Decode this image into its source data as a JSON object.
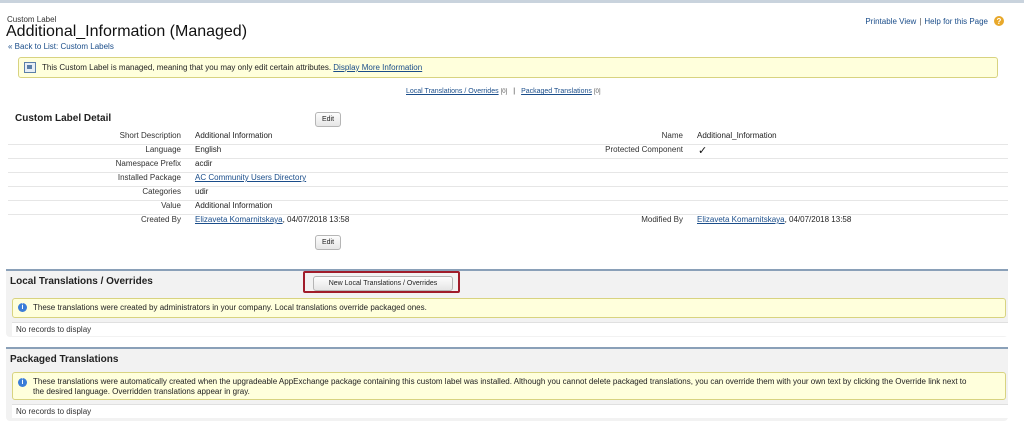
{
  "header": {
    "object_label": "Custom Label",
    "title": "Additional_Information (Managed)",
    "back_link": "« Back to List: Custom Labels",
    "printable_view": "Printable View",
    "separator": "|",
    "help": "Help for this Page",
    "help_icon_glyph": "?"
  },
  "notice": {
    "text": "This Custom Label is managed, meaning that you may only edit certain attributes.",
    "link": "Display More Information"
  },
  "related_links": {
    "local": "Local Translations / Overrides",
    "local_count": "[0]",
    "separator": "|",
    "packaged": "Packaged Translations",
    "packaged_count": "[0]"
  },
  "detail": {
    "title": "Custom Label Detail",
    "edit_label": "Edit",
    "fields": {
      "short_description_label": "Short Description",
      "short_description_value": "Additional Information",
      "name_label": "Name",
      "name_value": "Additional_Information",
      "language_label": "Language",
      "language_value": "English",
      "protected_label": "Protected Component",
      "protected_value": "✓",
      "namespace_label": "Namespace Prefix",
      "namespace_value": "acdir",
      "installed_package_label": "Installed Package",
      "installed_package_value": "AC Community Users Directory",
      "categories_label": "Categories",
      "categories_value": "udir",
      "value_label": "Value",
      "value_value": "Additional Information",
      "created_by_label": "Created By",
      "created_by_user": "Elizaveta Komarnitskaya",
      "created_by_date": ", 04/07/2018 13:58",
      "modified_by_label": "Modified By",
      "modified_by_user": "Elizaveta Komarnitskaya",
      "modified_by_date": ", 04/07/2018 13:58"
    }
  },
  "local_translations": {
    "title": "Local Translations / Overrides",
    "new_button": "New Local Translations / Overrides",
    "info": "These translations were created by administrators in your company. Local translations override packaged ones.",
    "empty": "No records to display"
  },
  "packaged_translations": {
    "title": "Packaged Translations",
    "info_line1": "These translations were automatically created when the upgradeable AppExchange package containing this custom label was installed. Although you cannot delete packaged translations, you can override them with your own text by clicking the Override link next to",
    "info_line2": "the desired language. Overridden translations appear in gray.",
    "empty": "No records to display"
  },
  "colors": {
    "link": "#1a4d8a",
    "notice_bg": "#ffffdc",
    "highlight": "#a01c2a",
    "section_border": "#8aa0b8"
  }
}
